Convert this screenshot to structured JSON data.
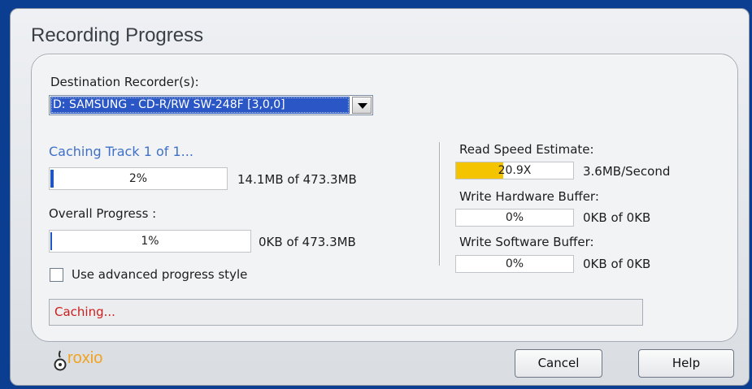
{
  "window": {
    "title": "Recording Progress"
  },
  "destination": {
    "label": "Destination Recorder(s):",
    "selected": "D: SAMSUNG - CD-R/RW SW-248F [3,0,0]"
  },
  "track": {
    "status_label": "Caching Track 1 of 1...",
    "percent_text": "2%",
    "fraction": 0.02,
    "size_text": "14.1MB of 473.3MB"
  },
  "overall": {
    "label": "Overall Progress :",
    "percent_text": "1%",
    "fraction": 0.01,
    "size_text": "0KB of 473.3MB"
  },
  "advanced": {
    "label": "Use advanced progress style",
    "checked": false
  },
  "read_speed": {
    "label": "Read Speed Estimate:",
    "value_text": "20.9X",
    "fill_fraction": 0.4,
    "rate_text": "3.6MB/Second"
  },
  "hw_buffer": {
    "label": "Write Hardware Buffer:",
    "percent_text": "0%",
    "size_text": "0KB of 0KB"
  },
  "sw_buffer": {
    "label": "Write Software Buffer:",
    "percent_text": "0%",
    "size_text": "0KB of 0KB"
  },
  "status_message": "Caching...",
  "buttons": {
    "cancel": "Cancel",
    "help": "Help"
  },
  "logo": {
    "text": "roxio",
    "icon": "roxio-logo-icon"
  },
  "colors": {
    "status_text": "#cc1d1d",
    "progress_fill": "#1f55c7",
    "speed_fill": "#f5c400",
    "caching_text": "#3f70c8"
  }
}
